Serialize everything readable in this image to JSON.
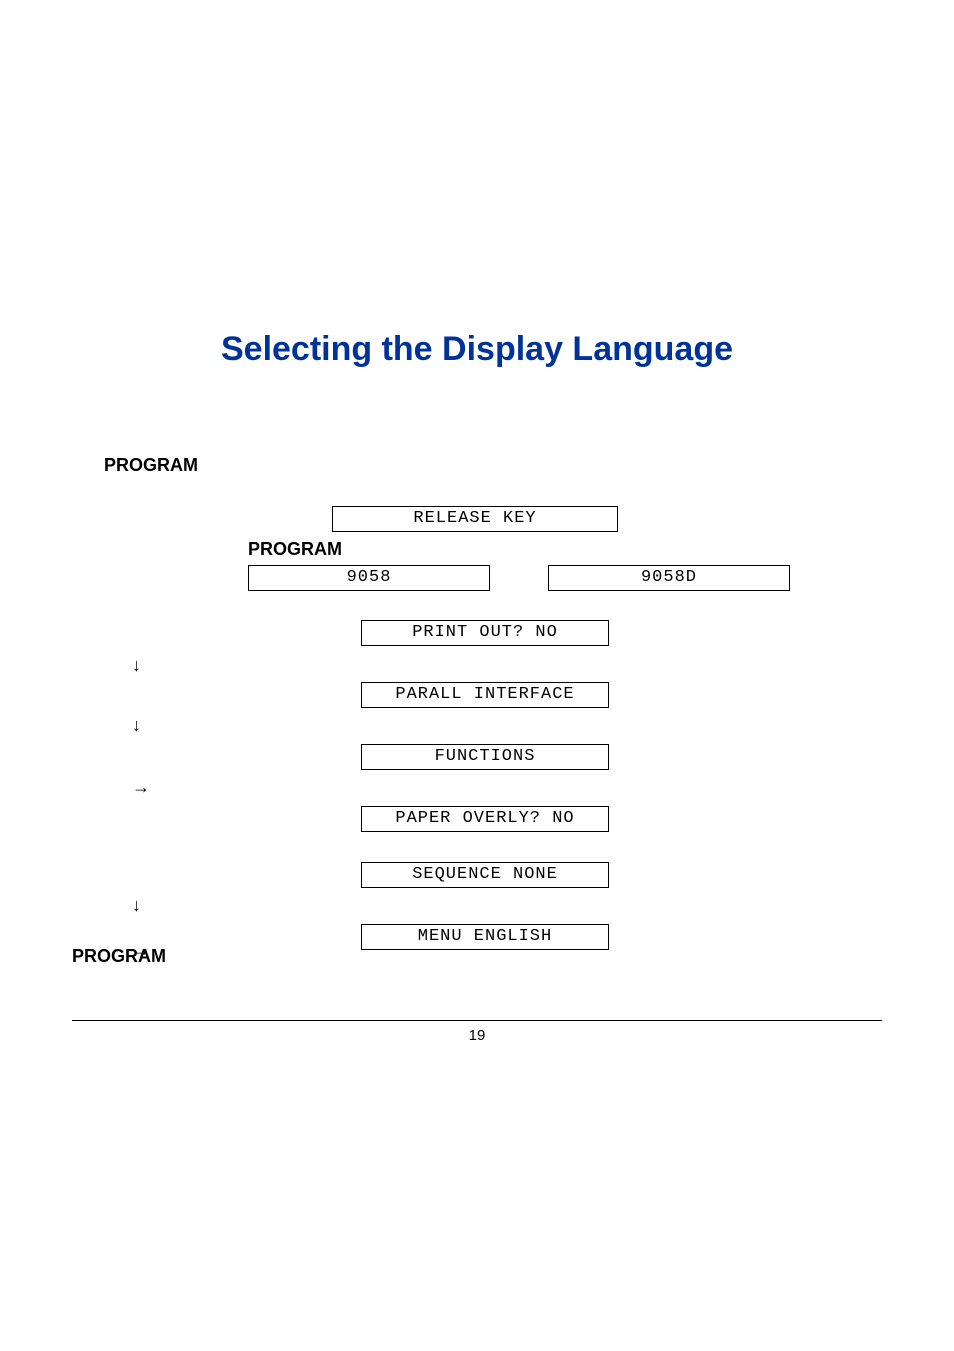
{
  "title": "Selecting the Display Language",
  "labels": {
    "program_top": "PROGRAM",
    "program_mid": "PROGRAM",
    "program_bottom": "PROGRAM"
  },
  "displays": {
    "release_key": "RELEASE KEY",
    "model_left": "9058",
    "model_right": "9058D",
    "print_out": "PRINT OUT? NO",
    "parall_interface": "PARALL INTERFACE",
    "functions": "FUNCTIONS",
    "paper_overly": "PAPER OVERLY? NO",
    "sequence": "SEQUENCE NONE",
    "menu": "MENU ENGLISH"
  },
  "arrows": {
    "a1": "↓",
    "a2": "↓",
    "a3": "→",
    "a4": "↓",
    "a5": "→"
  },
  "page_number": "19"
}
